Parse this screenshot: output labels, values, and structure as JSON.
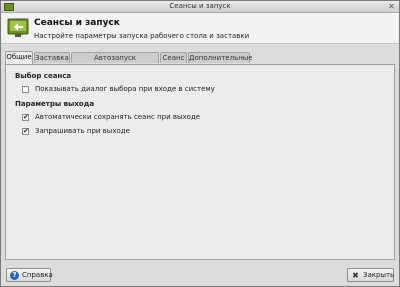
{
  "window": {
    "title": "Сеансы и запуск",
    "close_glyph": "✕"
  },
  "header": {
    "title": "Сеансы и запуск",
    "subtitle": "Настройте параметры запуска рабочего стола и заставки",
    "icon": "session-display-icon"
  },
  "tabs": [
    {
      "label": "Общие",
      "active": true
    },
    {
      "label": "Заставка",
      "active": false
    },
    {
      "label": "Автозапуск приложений",
      "active": false
    },
    {
      "label": "Сеанс",
      "active": false
    },
    {
      "label": "Дополнительные",
      "active": false
    }
  ],
  "general": {
    "session_section": {
      "title": "Выбор сеанса",
      "show_dialog": {
        "label": "Показывать диалог выбора при входе в систему",
        "checked": false
      }
    },
    "logout_section": {
      "title": "Параметры выхода",
      "auto_save": {
        "label": "Автоматически сохранять сеанс при выходе",
        "checked": true,
        "glyph": "✔"
      },
      "prompt_logout": {
        "label": "Запрашивать при выходе",
        "checked": true,
        "glyph": "✔"
      }
    }
  },
  "buttons": {
    "help": {
      "label": "Справка",
      "icon": "help-icon",
      "glyph": "?"
    },
    "close": {
      "label": "Закрыть",
      "icon": "close-icon",
      "glyph": "✖"
    }
  }
}
